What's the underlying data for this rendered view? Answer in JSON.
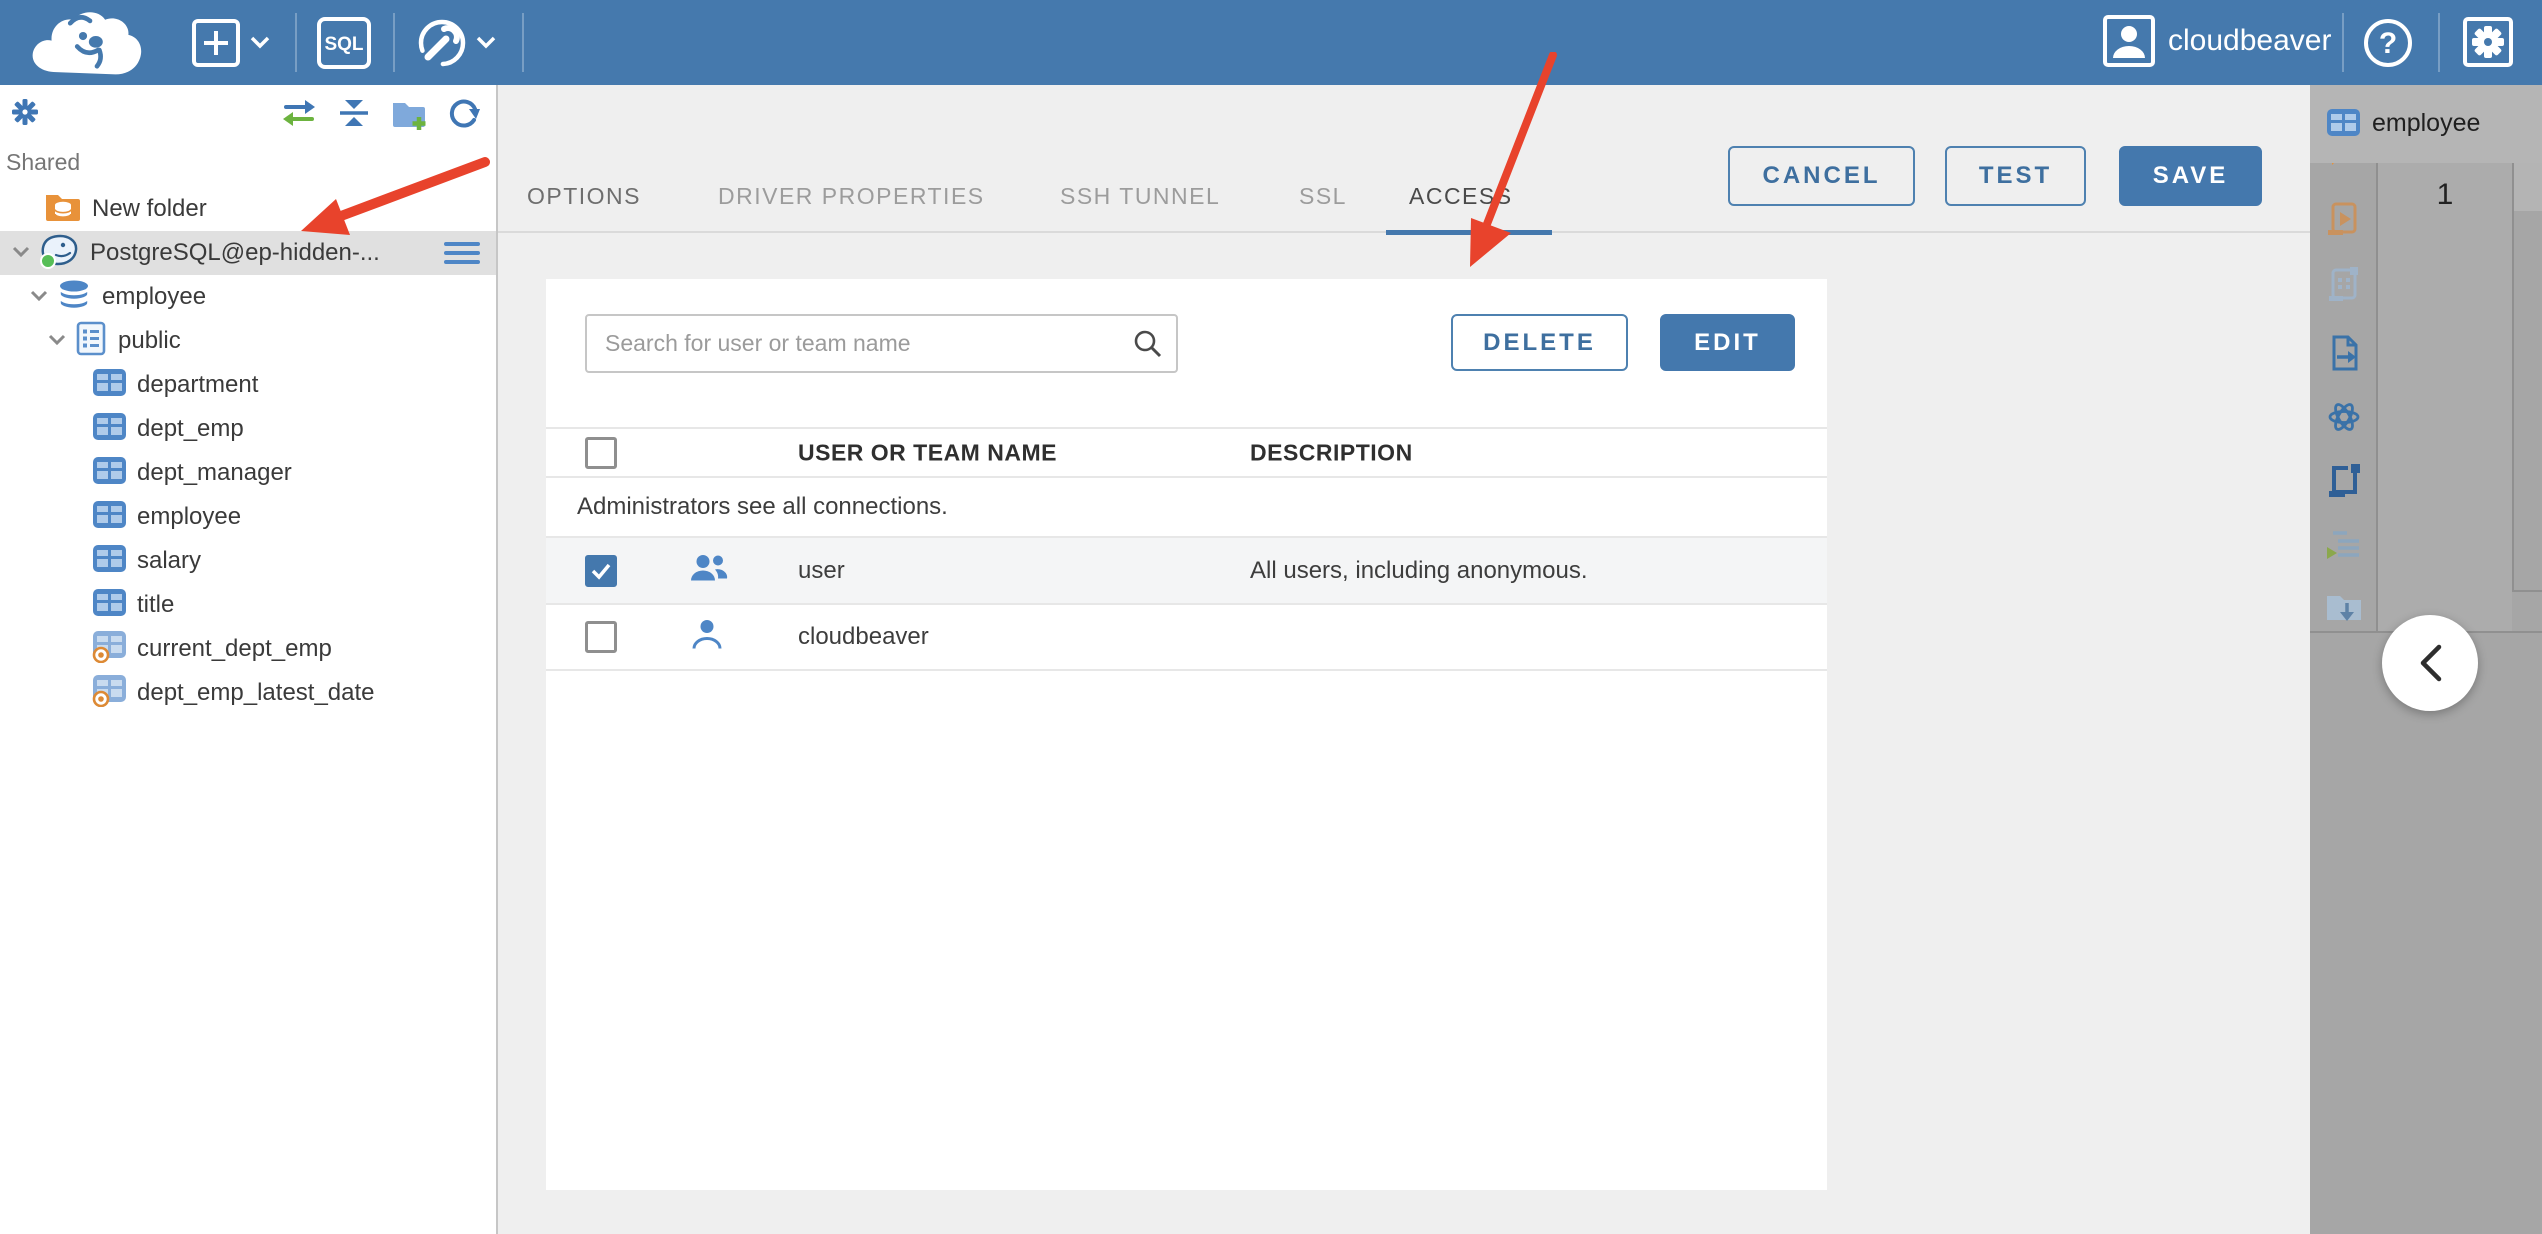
{
  "topbar": {
    "sql_badge": "SQL",
    "user_name": "cloudbeaver",
    "help_glyph": "?"
  },
  "sidebar": {
    "section_label": "Shared",
    "tree": [
      {
        "label": "New folder",
        "type": "folder"
      },
      {
        "label": "PostgreSQL@ep-hidden-...",
        "type": "connection",
        "selected": true
      },
      {
        "label": "employee",
        "type": "database"
      },
      {
        "label": "public",
        "type": "schema"
      },
      {
        "label": "department",
        "type": "table"
      },
      {
        "label": "dept_emp",
        "type": "table"
      },
      {
        "label": "dept_manager",
        "type": "table"
      },
      {
        "label": "employee",
        "type": "table"
      },
      {
        "label": "salary",
        "type": "table"
      },
      {
        "label": "title",
        "type": "table"
      },
      {
        "label": "current_dept_emp",
        "type": "view"
      },
      {
        "label": "dept_emp_latest_date",
        "type": "view"
      }
    ]
  },
  "connection_dialog": {
    "tabs": [
      {
        "label": "OPTIONS"
      },
      {
        "label": "DRIVER PROPERTIES"
      },
      {
        "label": "SSH TUNNEL"
      },
      {
        "label": "SSL"
      },
      {
        "label": "ACCESS",
        "active": true
      }
    ],
    "buttons": {
      "cancel": "CANCEL",
      "test": "TEST",
      "save": "SAVE"
    },
    "access": {
      "search_placeholder": "Search for user or team name",
      "delete_button": "DELETE",
      "edit_button": "EDIT",
      "columns": [
        "USER OR TEAM NAME",
        "DESCRIPTION"
      ],
      "info_row": "Administrators see all connections.",
      "rows": [
        {
          "name": "user",
          "description": "All users, including anonymous.",
          "checked": true,
          "icon": "team"
        },
        {
          "name": "cloudbeaver",
          "description": "",
          "checked": false,
          "icon": "user"
        }
      ]
    }
  },
  "right_panel": {
    "tab_label": "employee",
    "row_number": "1"
  },
  "colors": {
    "topbar": "#4579AD",
    "accent": "#4478AD",
    "arrow": "#E8432C",
    "tree_selection": "#E0E0E0"
  }
}
